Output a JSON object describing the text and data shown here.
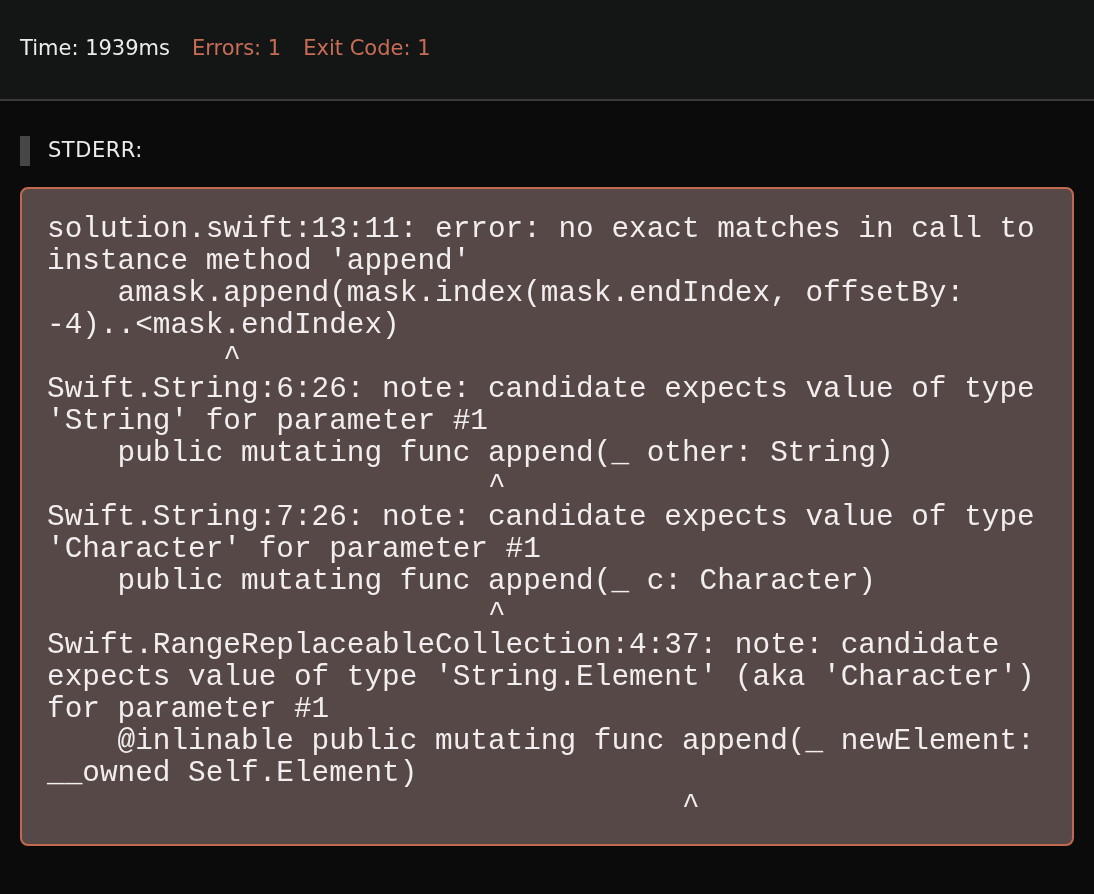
{
  "stats": [
    {
      "text": "Time: 1939ms",
      "kind": "info"
    },
    {
      "text": "Errors: 1",
      "kind": "error"
    },
    {
      "text": "Exit Code: 1",
      "kind": "error"
    }
  ],
  "stderr": {
    "label": "STDERR:",
    "output": "solution.swift:13:11: error: no exact matches in call to\ninstance method 'append'\n    amask.append(mask.index(mask.endIndex, offsetBy:\n-4)..<mask.endIndex)\n          ^\nSwift.String:6:26: note: candidate expects value of type\n'String' for parameter #1\n    public mutating func append(_ other: String)\n                         ^\nSwift.String:7:26: note: candidate expects value of type\n'Character' for parameter #1\n    public mutating func append(_ c: Character)\n                         ^\nSwift.RangeReplaceableCollection:4:37: note: candidate\nexpects value of type 'String.Element' (aka 'Character')\nfor parameter #1\n    @inlinable public mutating func append(_ newElement:\n__owned Self.Element)\n                                    ^"
  }
}
